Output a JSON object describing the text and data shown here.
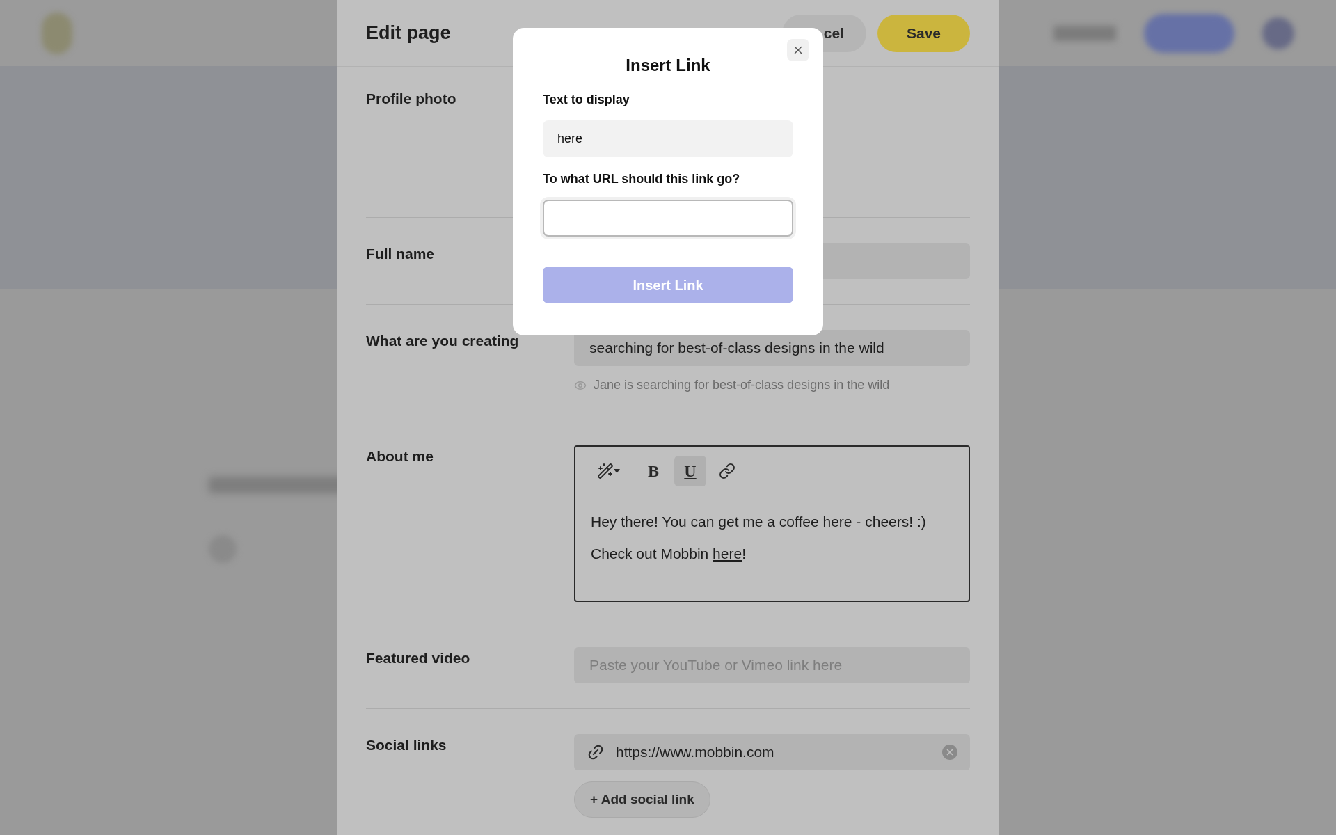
{
  "header": {
    "title": "Edit page",
    "cancel_button": "cel",
    "save_button": "Save"
  },
  "sections": [
    {
      "kind": "photo",
      "label": "Profile photo"
    },
    {
      "kind": "text",
      "label": "Full name"
    },
    {
      "kind": "text",
      "label": "What are you creating",
      "value": "searching for best-of-class designs in the wild",
      "hint": "Jane is searching for best-of-class designs in the wild"
    },
    {
      "kind": "editor",
      "label": "About me",
      "toolbar": [
        {
          "kind": "magic",
          "selected": false
        },
        {
          "kind": "bold",
          "label": "B",
          "selected": false
        },
        {
          "kind": "underline",
          "label": "U",
          "selected": true
        },
        {
          "kind": "link",
          "selected": false
        }
      ],
      "paragraphs": [
        {
          "text": "Hey there! You can get me a coffee here - cheers! :)"
        },
        {
          "text": "Check out Mobbin ",
          "link": "here",
          "after": "!"
        }
      ]
    },
    {
      "kind": "text",
      "label": "Featured video",
      "placeholder": "Paste your YouTube or Vimeo link here"
    },
    {
      "kind": "social",
      "label": "Social links",
      "links": [
        {
          "url": "https://www.mobbin.com"
        }
      ],
      "add_button": "+ Add social link"
    }
  ],
  "dialog": {
    "title": "Insert Link",
    "fields": [
      {
        "label": "Text to display",
        "value": "here",
        "focused": false
      },
      {
        "label": "To what URL should this link go?",
        "focused": true
      }
    ],
    "button": {
      "label": "Insert Link",
      "disabled": true
    }
  }
}
